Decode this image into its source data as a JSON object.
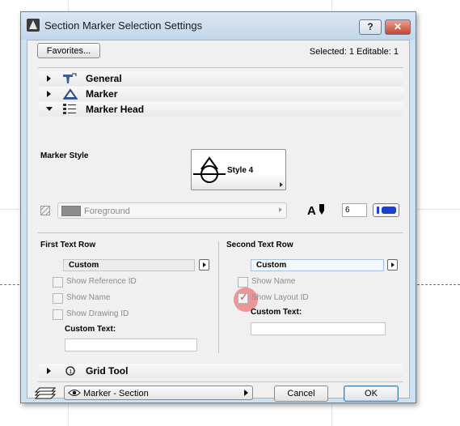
{
  "window": {
    "title": "Section Marker Selection Settings",
    "help_label": "?",
    "close_label": "✕"
  },
  "toolbar": {
    "favorites_label": "Favorites...",
    "selected_info": "Selected: 1 Editable: 1"
  },
  "sections": {
    "general": "General",
    "marker": "Marker",
    "marker_head": "Marker Head",
    "grid_tool": "Grid Tool"
  },
  "marker_head": {
    "marker_style_label": "Marker Style",
    "style_name": "Style 4",
    "pen_label": "Foreground",
    "pen_color": "#8c8c8c",
    "font_size_value": "6",
    "accent_color": "#1a3fd6"
  },
  "first_text_row": {
    "heading": "First Text Row",
    "dropdown_value": "Custom",
    "show_reference_id": "Show Reference ID",
    "show_name": "Show Name",
    "show_drawing_id": "Show Drawing ID",
    "custom_text_label": "Custom Text:"
  },
  "second_text_row": {
    "heading": "Second Text Row",
    "dropdown_value": "Custom",
    "show_name": "Show Name",
    "show_layout_id": "Show Layout ID",
    "show_layout_id_checked": true,
    "custom_text_label": "Custom Text:"
  },
  "footer": {
    "view_label": "Marker - Section",
    "cancel_label": "Cancel",
    "ok_label": "OK"
  }
}
